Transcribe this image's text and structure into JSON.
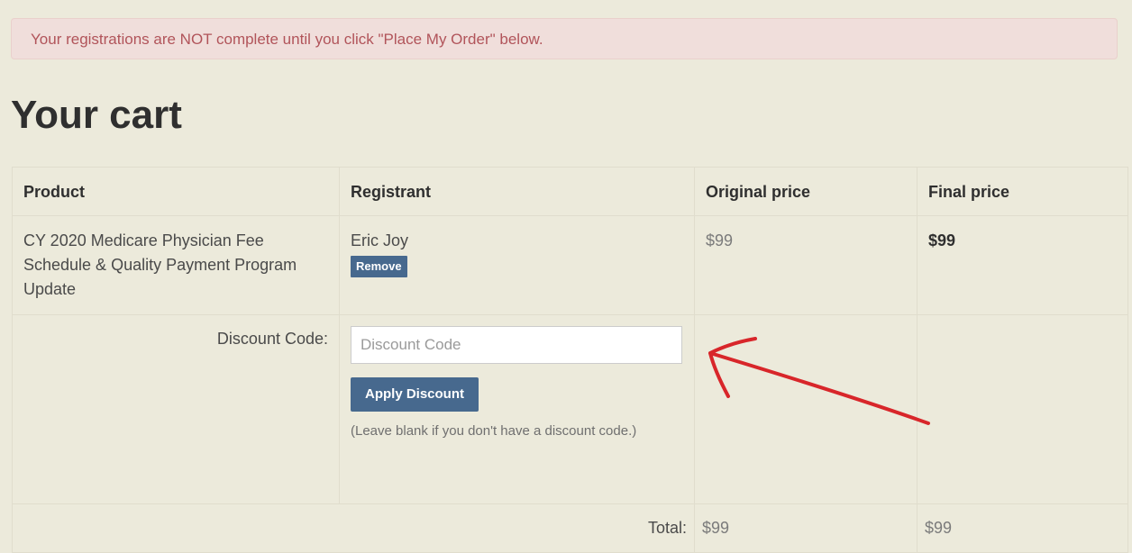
{
  "alert": {
    "message": "Your registrations are NOT complete until you click \"Place My Order\" below."
  },
  "page": {
    "title": "Your cart"
  },
  "cart": {
    "columns": [
      "Product",
      "Registrant",
      "Original price",
      "Final price"
    ],
    "items": [
      {
        "product": "CY 2020 Medicare Physician Fee Schedule & Quality Payment Program Update",
        "registrant": "Eric Joy",
        "remove_label": "Remove",
        "original_price": "$99",
        "final_price": "$99"
      }
    ],
    "discount": {
      "label": "Discount Code:",
      "placeholder": "Discount Code",
      "value": "",
      "apply_label": "Apply Discount",
      "help": "(Leave blank if you don't have a discount code.)"
    },
    "total": {
      "label": "Total:",
      "original": "$99",
      "final": "$99"
    }
  },
  "annotation": {
    "type": "hand-drawn arrow",
    "color": "#d8262a"
  },
  "colors": {
    "background": "#eceadb",
    "alert_bg": "#f0dedb",
    "alert_text": "#b1545a",
    "button": "#47698e"
  }
}
